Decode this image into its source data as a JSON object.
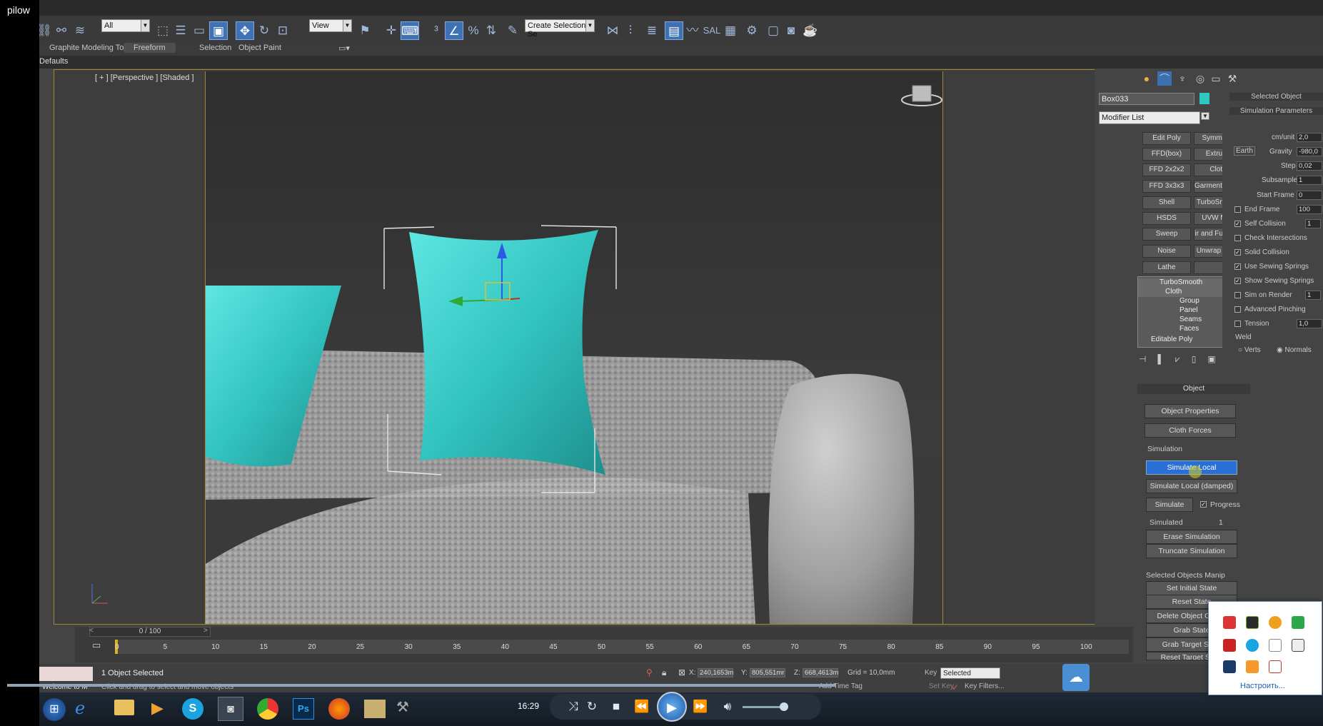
{
  "video_title": "pilow",
  "toolbar": {
    "selection_filter": "All",
    "ref_coord": "View",
    "named_selection": "Create Selection Se",
    "label_sal": "SAL"
  },
  "ribbon": {
    "tabs": [
      "Graphite Modeling Tools",
      "Freeform",
      "Selection",
      "Object Paint"
    ],
    "active": "Freeform"
  },
  "defaults_label": "Defaults",
  "viewport": {
    "label": "[ + ] [Perspective ] [Shaded ]"
  },
  "command_panel": {
    "object_name": "Box033",
    "object_color": "#2ec8c0",
    "modifier_list": "Modifier List",
    "modifier_buttons": [
      [
        "Edit Poly",
        "Symmetry"
      ],
      [
        "FFD(box)",
        "Extrude"
      ],
      [
        "FFD 2x2x2",
        "Cloth"
      ],
      [
        "FFD 3x3x3",
        "Garment Maker"
      ],
      [
        "Shell",
        "TurboSmooth"
      ],
      [
        "HSDS",
        "UVW Map"
      ],
      [
        "Sweep",
        "ir and Fur (WS"
      ],
      [
        "Noise",
        "Unwrap UVW"
      ],
      [
        "Lathe",
        ""
      ]
    ],
    "stack": [
      "TurboSmooth",
      "Cloth",
      "Group",
      "Panel",
      "Seams",
      "Faces",
      "Editable Poly"
    ],
    "object_rollout": "Object",
    "object_properties": "Object Properties",
    "cloth_forces": "Cloth Forces",
    "simulation_group": "Simulation",
    "simulate_local": "Simulate Local",
    "simulate_local_damped": "Simulate Local (damped)",
    "simulate": "Simulate",
    "progress": "Progress",
    "simulated_label": "Simulated",
    "simulated_value": "1",
    "erase_simulation": "Erase Simulation",
    "truncate_simulation": "Truncate Simulation",
    "selected_objects_group": "Selected Objects Manip",
    "set_initial_state": "Set Initial State",
    "reset_state": "Reset State",
    "delete_object_cache": "Delete Object Cache",
    "grab_state": "Grab State",
    "grab_target_state": "Grab Target State",
    "reset_target_state": "Reset Target State"
  },
  "sim_panel": {
    "selected_object": "Selected Object",
    "sim_params": "Simulation Parameters",
    "cm_unit_label": "cm/unit",
    "cm_unit": "2,0",
    "earth": "Earth",
    "gravity_label": "Gravity",
    "gravity": "-980,0",
    "step_label": "Step",
    "step": "0,02",
    "subsample_label": "Subsample",
    "subsample": "1",
    "start_frame_label": "Start Frame",
    "start_frame": "0",
    "end_frame_label": "End Frame",
    "end_frame": "100",
    "self_collision": "Self Collision",
    "self_collision_val": "1",
    "check_intersections": "Check Intersections",
    "solid_collision": "Solid Collision",
    "use_sewing_springs": "Use Sewing Springs",
    "show_sewing_springs": "Show Sewing Springs",
    "sim_on_render": "Sim on Render",
    "sim_on_render_val": "1",
    "advanced_pinching": "Advanced Pinching",
    "tension": "Tension",
    "tension_val": "1,0",
    "weld": "Weld",
    "verts": "Verts",
    "normals": "Normals"
  },
  "timeline": {
    "frame": "0 / 100",
    "ticks": [
      "0",
      "5",
      "10",
      "15",
      "20",
      "25",
      "30",
      "35",
      "40",
      "45",
      "50",
      "55",
      "60",
      "65",
      "70",
      "75",
      "80",
      "85",
      "90",
      "95",
      "100"
    ]
  },
  "status": {
    "selected": "1 Object Selected",
    "prompt": "Click and drag to select and move objects",
    "x_label": "X:",
    "x": "240,1653m",
    "y_label": "Y:",
    "y": "805,551mr",
    "z_label": "Z:",
    "z": "668,4613m",
    "grid": "Grid = 10,0mm",
    "add_time_tag": "Add Time Tag",
    "key_mode": "Selected",
    "key_filters": "Key Filters...",
    "set_key": "Set Key",
    "auto_key": "Key",
    "script": "Welcome to M"
  },
  "player": {
    "time": "16:29"
  },
  "tray": {
    "customize": "Настроить..."
  }
}
